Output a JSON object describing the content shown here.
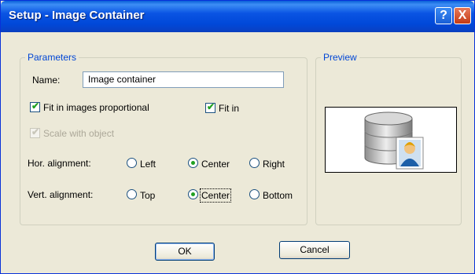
{
  "window": {
    "title": "Setup - Image Container"
  },
  "titlebar_buttons": {
    "help": "?",
    "close": "X"
  },
  "parameters": {
    "legend": "Parameters",
    "name_label": "Name:",
    "name_value": "Image container",
    "fit_proportional": {
      "label": "Fit in images proportional",
      "checked": true
    },
    "fit_in": {
      "label": "Fit in",
      "checked": true
    },
    "scale_with_object": {
      "label": "Scale with object",
      "checked": true,
      "enabled": false
    },
    "hor_alignment": {
      "label": "Hor. alignment:",
      "options": [
        "Left",
        "Center",
        "Right"
      ],
      "selected": "Center"
    },
    "vert_alignment": {
      "label": "Vert. alignment:",
      "options": [
        "Top",
        "Center",
        "Bottom"
      ],
      "selected": "Center"
    }
  },
  "preview": {
    "legend": "Preview",
    "icon": "database-user-icon"
  },
  "buttons": {
    "ok": "OK",
    "cancel": "Cancel"
  },
  "colors": {
    "accent": "#0046d5",
    "check": "#21a121",
    "title_bg": "#0a54e3"
  }
}
